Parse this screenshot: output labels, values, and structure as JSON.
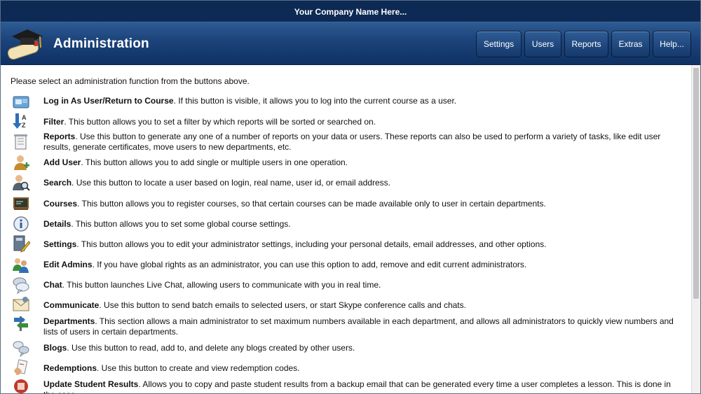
{
  "company": "Your Company Name Here...",
  "header": {
    "title": "Administration"
  },
  "nav": [
    {
      "label": "Settings"
    },
    {
      "label": "Users"
    },
    {
      "label": "Reports"
    },
    {
      "label": "Extras"
    },
    {
      "label": "Help..."
    }
  ],
  "intro": "Please select an administration function from the buttons above.",
  "items": [
    {
      "icon": "card-icon",
      "title": "Log in As User/Return to Course",
      "desc": ". If this button is visible, it allows you to log into the current course as a user."
    },
    {
      "icon": "sort-az-icon",
      "title": "Filter",
      "desc": ". This button allows you to set a filter by which reports will be sorted or searched on."
    },
    {
      "icon": "document-icon",
      "title": "Reports",
      "desc": ". Use this button to generate any one of a number of reports on your data or users. These reports can also be used to perform a variety of tasks, like edit user results, generate certificates, move users to new departments, etc."
    },
    {
      "icon": "add-user-icon",
      "title": "Add User",
      "desc": ". This button allows you to add single or multiple users in one operation."
    },
    {
      "icon": "search-user-icon",
      "title": "Search",
      "desc": ". Use this button to locate a user based on login, real name, user id, or email address."
    },
    {
      "icon": "chalkboard-icon",
      "title": "Courses",
      "desc": ". This button allows you to register courses, so that certain courses can be made available only to user in certain departments."
    },
    {
      "icon": "info-icon",
      "title": "Details",
      "desc": ". This button allows you to set some global course settings."
    },
    {
      "icon": "edit-settings-icon",
      "title": "Settings",
      "desc": ". This button allows you to edit your administrator settings, including your personal details, email addresses, and other options."
    },
    {
      "icon": "admins-icon",
      "title": "Edit Admins",
      "desc": ". If you have global rights as an administrator, you can use this option to add, remove and edit current administrators."
    },
    {
      "icon": "chat-icon",
      "title": "Chat",
      "desc": ". This button launches Live Chat, allowing users to communicate with you in real time."
    },
    {
      "icon": "envelope-icon",
      "title": "Communicate",
      "desc": ". Use this button to send batch emails to selected users, or start Skype conference calls and chats."
    },
    {
      "icon": "signpost-icon",
      "title": "Departments",
      "desc": ". This section allows a main administrator to set maximum numbers available in each department, and allows all administrators to quickly view numbers and lists of users in certain departments."
    },
    {
      "icon": "blogs-icon",
      "title": "Blogs",
      "desc": ". Use this button to read, add to, and delete any blogs created by other users."
    },
    {
      "icon": "redemption-icon",
      "title": "Redemptions",
      "desc": ". Use this button to create and view redemption codes."
    },
    {
      "icon": "update-results-icon",
      "title": "Update Student Results",
      "desc": ". Allows you to copy and paste student results from a backup email that can be generated every time a user completes a lesson. This is done in the case"
    }
  ]
}
